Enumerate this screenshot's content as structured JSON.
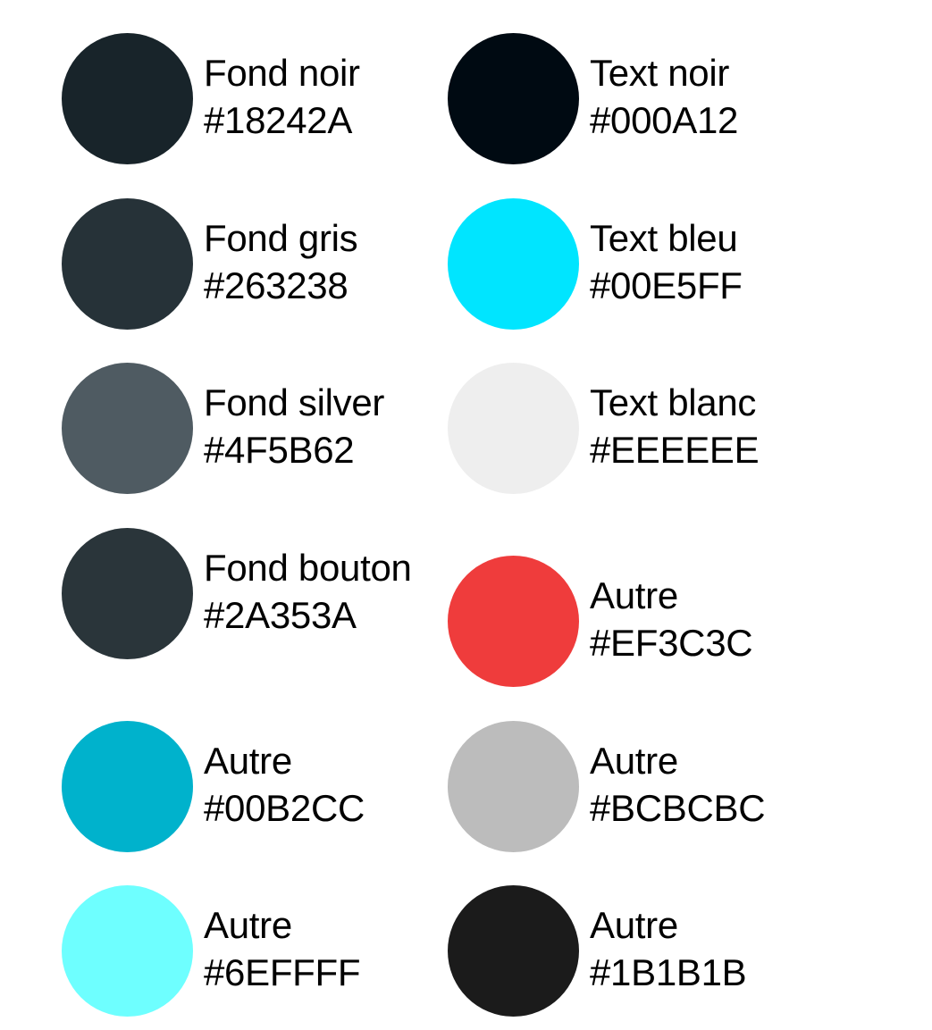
{
  "palette": {
    "left": [
      {
        "name": "Fond noir",
        "hex": "#18242A",
        "color": "#18242A"
      },
      {
        "name": "Fond gris",
        "hex": "#263238",
        "color": "#263238"
      },
      {
        "name": "Fond silver",
        "hex": "#4F5B62",
        "color": "#4F5B62"
      },
      {
        "name": "Fond bouton",
        "hex": "#2A353A",
        "color": "#2A353A"
      },
      {
        "name": "Autre",
        "hex": "#00B2CC",
        "color": "#00B2CC"
      },
      {
        "name": "Autre",
        "hex": "#6EFFFF",
        "color": "#6EFFFF"
      }
    ],
    "right": [
      {
        "name": "Text noir",
        "hex": "#000A12",
        "color": "#000A12"
      },
      {
        "name": "Text bleu",
        "hex": "#00E5FF",
        "color": "#00E5FF"
      },
      {
        "name": "Text blanc",
        "hex": "#EEEEEE",
        "color": "#EEEEEE"
      },
      {
        "name": "Autre",
        "hex": "#EF3C3C",
        "color": "#EF3C3C"
      },
      {
        "name": "Autre",
        "hex": "#BCBCBC",
        "color": "#BCBCBC"
      },
      {
        "name": "Autre",
        "hex": "#1B1B1B",
        "color": "#1B1B1B"
      }
    ]
  }
}
